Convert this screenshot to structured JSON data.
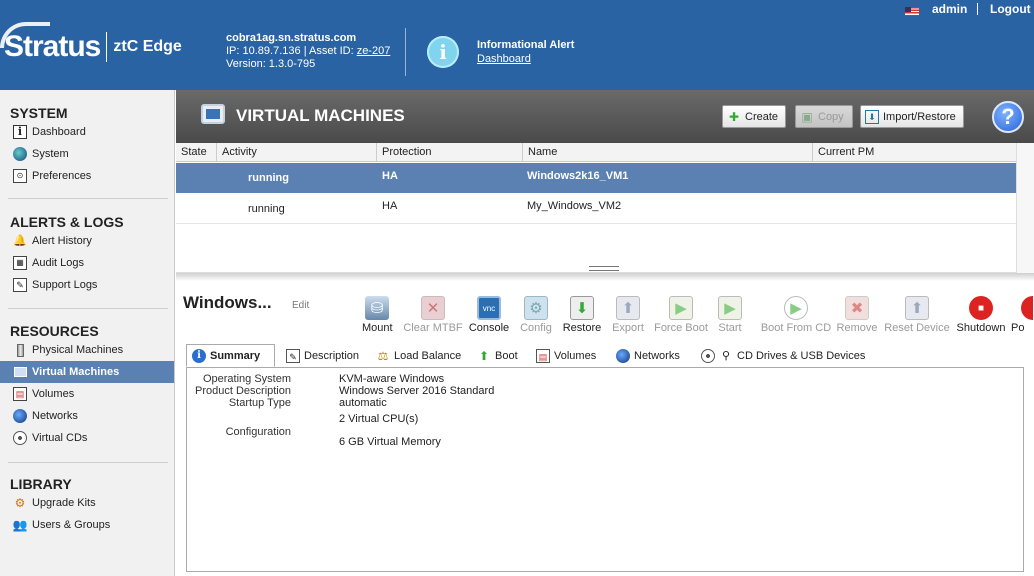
{
  "header": {
    "logo": "Stratus",
    "product": "ztC Edge",
    "hostname": "cobra1ag.sn.stratus.com",
    "ip_label": "IP: 10.89.7.136",
    "separator": "|",
    "asset_label": "Asset ID:",
    "asset_id": "ze-207",
    "version": "Version: 1.3.0-795",
    "alert_title": "Informational Alert",
    "alert_link": "Dashboard",
    "user": "admin",
    "logout": "Logout"
  },
  "sidebar": {
    "sections": [
      {
        "title": "SYSTEM",
        "items": [
          {
            "label": "Dashboard",
            "icon": "info-icon"
          },
          {
            "label": "System",
            "icon": "globe-icon"
          },
          {
            "label": "Preferences",
            "icon": "preferences-icon"
          }
        ]
      },
      {
        "title": "ALERTS & LOGS",
        "items": [
          {
            "label": "Alert History",
            "icon": "bell-icon"
          },
          {
            "label": "Audit Logs",
            "icon": "calendar-icon"
          },
          {
            "label": "Support Logs",
            "icon": "document-icon"
          }
        ]
      },
      {
        "title": "RESOURCES",
        "items": [
          {
            "label": "Physical Machines",
            "icon": "server-icon"
          },
          {
            "label": "Virtual Machines",
            "icon": "monitor-icon",
            "active": true
          },
          {
            "label": "Volumes",
            "icon": "volume-icon"
          },
          {
            "label": "Networks",
            "icon": "network-icon"
          },
          {
            "label": "Virtual CDs",
            "icon": "cd-icon"
          }
        ]
      },
      {
        "title": "LIBRARY",
        "items": [
          {
            "label": "Upgrade Kits",
            "icon": "kit-icon"
          },
          {
            "label": "Users & Groups",
            "icon": "users-icon"
          }
        ]
      }
    ]
  },
  "main": {
    "title": "VIRTUAL MACHINES",
    "buttons": {
      "create": "Create",
      "copy": "Copy",
      "import_restore": "Import/Restore"
    },
    "help": "?",
    "columns": [
      "State",
      "Activity",
      "Protection",
      "Name",
      "Current PM"
    ],
    "rows": [
      {
        "state": "",
        "activity": "running",
        "protection": "HA",
        "name": "Windows2k16_VM1",
        "current_pm": "",
        "selected": true
      },
      {
        "state": "",
        "activity": "running",
        "protection": "HA",
        "name": "My_Windows_VM2",
        "current_pm": "",
        "selected": false
      }
    ]
  },
  "detail": {
    "name": "Windows...",
    "edit": "Edit",
    "actions": [
      {
        "label": "Mount",
        "enabled": true
      },
      {
        "label": "Clear MTBF",
        "enabled": false
      },
      {
        "label": "Console",
        "enabled": true
      },
      {
        "label": "Config",
        "enabled": false
      },
      {
        "label": "Restore",
        "enabled": true
      },
      {
        "label": "Export",
        "enabled": false
      },
      {
        "label": "Force Boot",
        "enabled": false
      },
      {
        "label": "Start",
        "enabled": false
      },
      {
        "label": "Boot From CD",
        "enabled": false
      },
      {
        "label": "Remove",
        "enabled": false
      },
      {
        "label": "Reset Device",
        "enabled": false
      },
      {
        "label": "Shutdown",
        "enabled": true
      },
      {
        "label": "Po",
        "enabled": true
      }
    ],
    "tabs": [
      {
        "label": "Summary",
        "active": true
      },
      {
        "label": "Description"
      },
      {
        "label": "Load Balance"
      },
      {
        "label": "Boot"
      },
      {
        "label": "Volumes"
      },
      {
        "label": "Networks"
      },
      {
        "label": "CD Drives & USB Devices"
      }
    ],
    "summary": {
      "os_label": "Operating System",
      "os_value": "KVM-aware Windows",
      "desc_label": "Product Description",
      "desc_value": "Windows Server 2016 Standard",
      "startup_label": "Startup Type",
      "startup_value": "automatic",
      "config_label": "Configuration",
      "cpu_value": "2 Virtual CPU(s)",
      "memory_value": "6 GB Virtual Memory"
    }
  },
  "colors": {
    "header_bg": "#2a63a4",
    "selection": "#5b80b2",
    "titlebar": "#555555"
  }
}
